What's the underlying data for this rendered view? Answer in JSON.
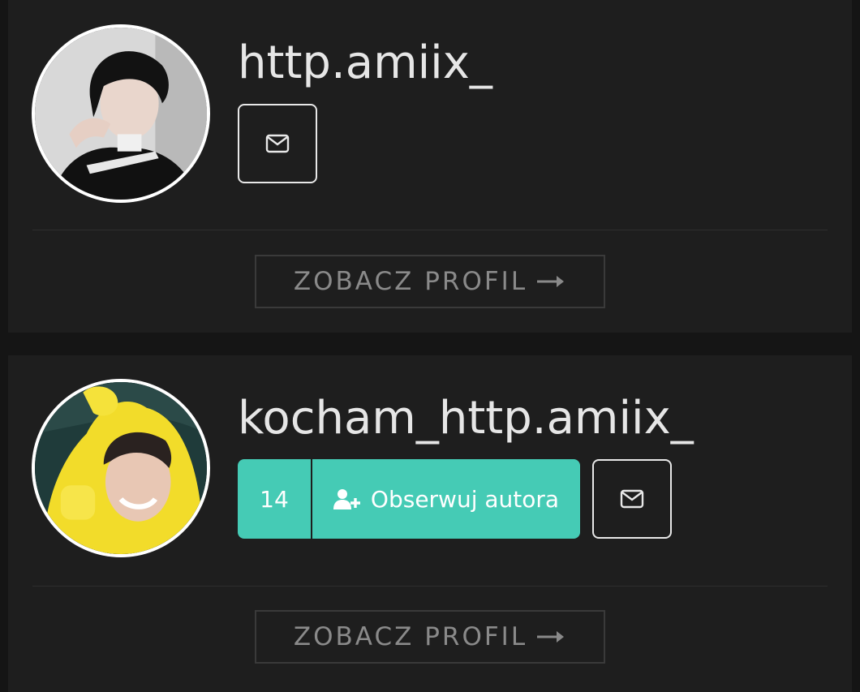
{
  "authors": [
    {
      "username": "http.amiix_",
      "profile_button": "ZOBACZ PROFIL",
      "avatar_icon": "avatar-person-dark-hair",
      "message_icon": "envelope-icon"
    },
    {
      "username": "kocham_http.amiix_",
      "followers_count": "14",
      "follow_label": "Obserwuj autora",
      "profile_button": "ZOBACZ PROFIL",
      "avatar_icon": "avatar-person-yellow-hood",
      "message_icon": "envelope-icon"
    }
  ],
  "colors": {
    "page_bg": "#151515",
    "card_bg": "#1e1e1e",
    "accent": "#45cbb5",
    "text": "#e6e6e6",
    "muted": "#8a8a8a"
  }
}
